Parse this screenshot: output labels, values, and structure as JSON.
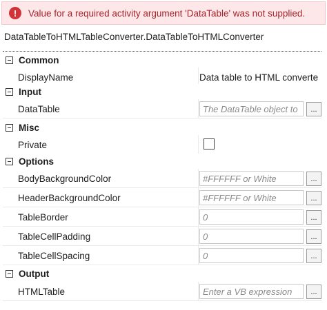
{
  "error": {
    "icon": "exclamation-icon",
    "glyph": "!",
    "message": "Value for a required activity argument 'DataTable' was not supplied."
  },
  "type_name": "DataTableToHTMLTableConverter.DataTableToHTMLConverter",
  "ellipsis_label": "...",
  "categories": {
    "common": {
      "label": "Common"
    },
    "input": {
      "label": "Input"
    },
    "misc": {
      "label": "Misc"
    },
    "options": {
      "label": "Options"
    },
    "output": {
      "label": "Output"
    }
  },
  "properties": {
    "display_name": {
      "name": "DisplayName",
      "value": "Data table to HTML converte"
    },
    "data_table": {
      "name": "DataTable",
      "placeholder": "The DataTable object to"
    },
    "private": {
      "name": "Private",
      "checked": false
    },
    "body_background_color": {
      "name": "BodyBackgroundColor",
      "placeholder": "#FFFFFF or White"
    },
    "header_background_color": {
      "name": "HeaderBackgroundColor",
      "placeholder": "#FFFFFF or White"
    },
    "table_border": {
      "name": "TableBorder",
      "placeholder": "0"
    },
    "table_cell_padding": {
      "name": "TableCellPadding",
      "placeholder": "0"
    },
    "table_cell_spacing": {
      "name": "TableCellSpacing",
      "placeholder": "0"
    },
    "html_table": {
      "name": "HTMLTable",
      "placeholder": "Enter a VB expression"
    }
  }
}
